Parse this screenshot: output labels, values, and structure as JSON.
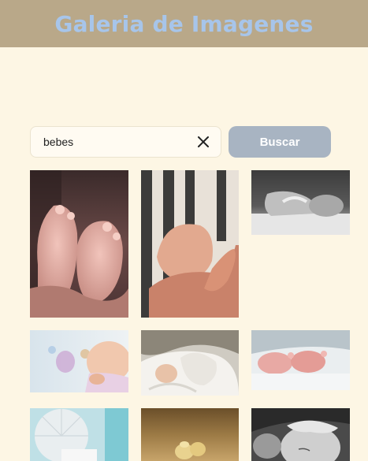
{
  "header": {
    "title": "Galeria de Imagenes"
  },
  "search": {
    "value": "bebes",
    "button_label": "Buscar"
  },
  "gallery": {
    "images": [
      {
        "id": "img-1",
        "subject": "baby-feet-held-in-hands"
      },
      {
        "id": "img-2",
        "subject": "baby-hand-holding-finger"
      },
      {
        "id": "img-3",
        "subject": "baby-on-bed-black-and-white"
      },
      {
        "id": "img-4",
        "subject": "baby-lying-profile"
      },
      {
        "id": "img-5",
        "subject": "baby-sleeping-in-white-blanket"
      },
      {
        "id": "img-6",
        "subject": "baby-feet-on-bed"
      },
      {
        "id": "img-7",
        "subject": "white-baby-item-on-blue"
      },
      {
        "id": "img-8",
        "subject": "baby-shoes-on-sand"
      },
      {
        "id": "img-9",
        "subject": "sleeping-baby-black-and-white"
      }
    ]
  },
  "colors": {
    "page_background": "#fdf6e4",
    "header_background": "#b9a889",
    "title_color": "#a7c5ea",
    "button_background": "#a8b4c2"
  }
}
